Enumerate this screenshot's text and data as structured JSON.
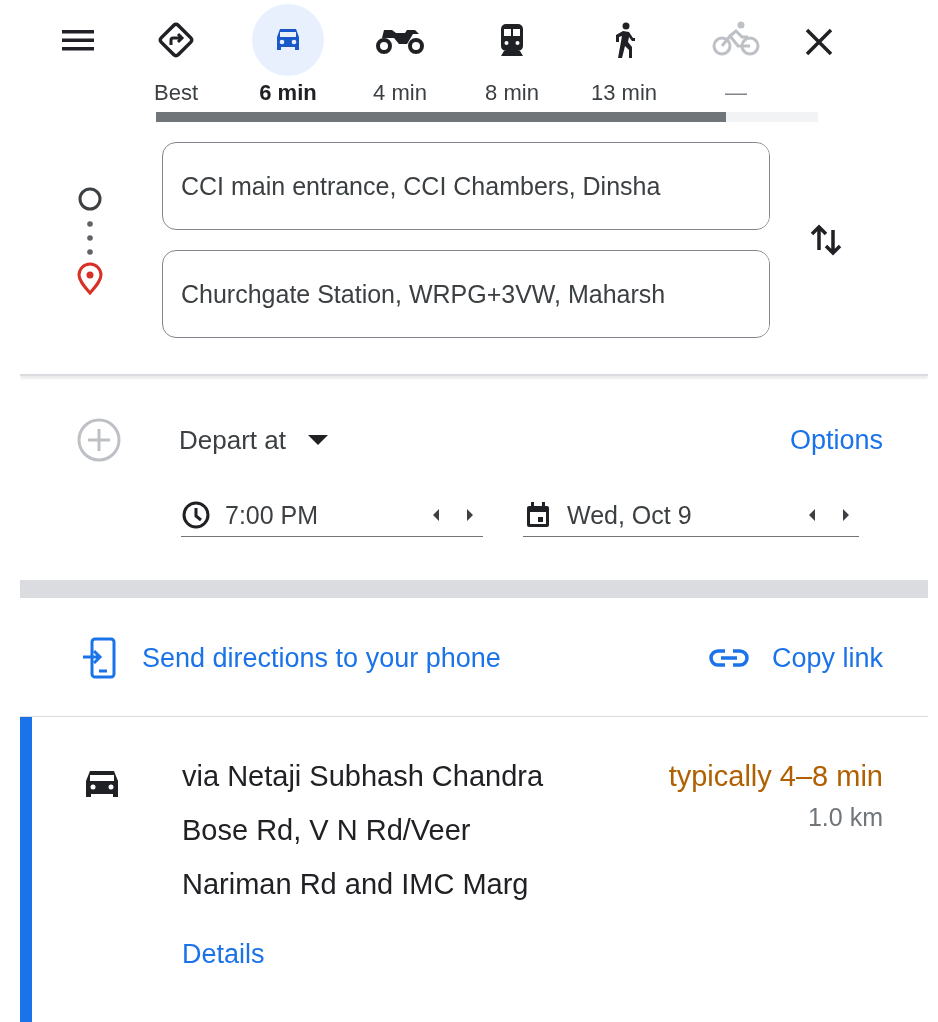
{
  "modes": [
    {
      "kind": "best",
      "label": "Best",
      "selected": false,
      "disabled": false
    },
    {
      "kind": "car",
      "label": "6 min",
      "selected": true,
      "disabled": false
    },
    {
      "kind": "motorcycle",
      "label": "4 min",
      "selected": false,
      "disabled": false
    },
    {
      "kind": "train",
      "label": "8 min",
      "selected": false,
      "disabled": false
    },
    {
      "kind": "walk",
      "label": "13 min",
      "selected": false,
      "disabled": false
    },
    {
      "kind": "bicycle",
      "label": "—",
      "selected": false,
      "disabled": true
    }
  ],
  "origin": {
    "value": "CCI main entrance, CCI Chambers, Dinsha"
  },
  "destination": {
    "value": "Churchgate Station, WRPG+3VW, Maharsh"
  },
  "depart": {
    "label": "Depart at",
    "options": "Options",
    "time": "7:00 PM",
    "date": "Wed, Oct 9"
  },
  "share": {
    "send": "Send directions to your phone",
    "copy": "Copy link"
  },
  "route": {
    "selected": true,
    "via": "via Netaji Subhash Chandra Bose Rd, V N Rd/Veer Nariman Rd and IMC Marg",
    "duration": "typically 4–8 min",
    "distance": "1.0 km",
    "details": "Details"
  }
}
